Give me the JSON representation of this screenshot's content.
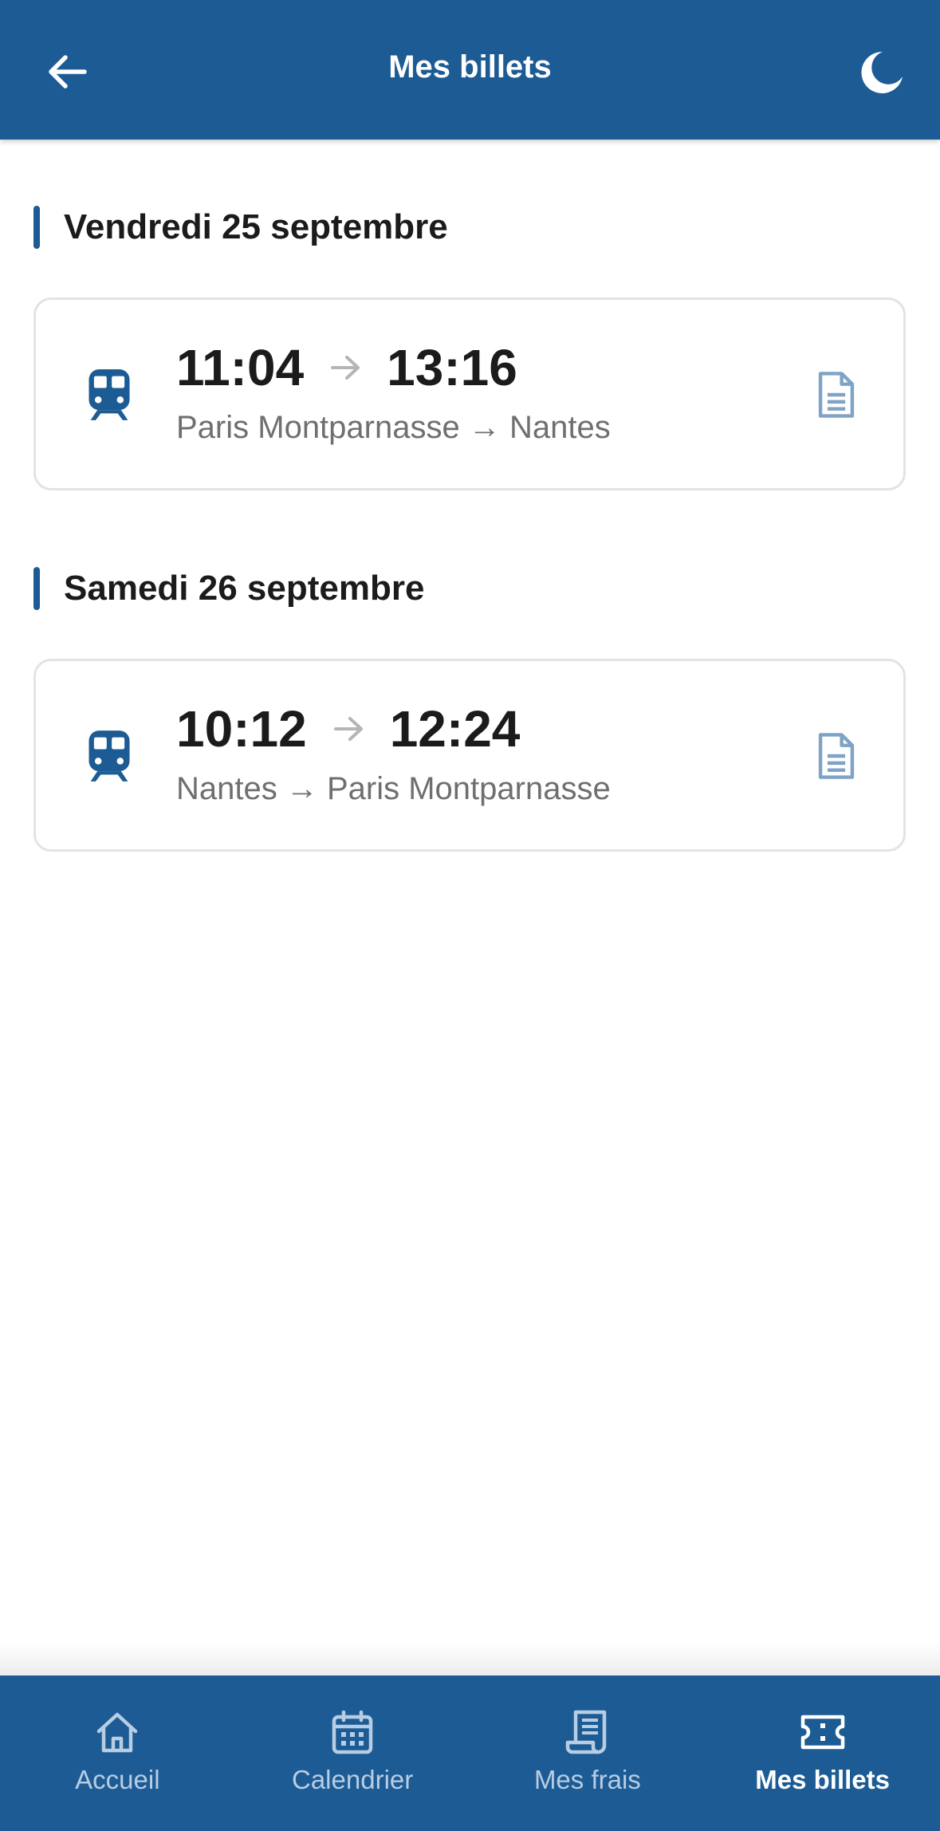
{
  "header": {
    "title": "Mes billets",
    "back_icon": "arrow-left-icon",
    "theme_icon": "moon-icon"
  },
  "sections": [
    {
      "date": "Vendredi 25 septembre",
      "tickets": [
        {
          "departure_time": "11:04",
          "arrival_time": "13:16",
          "route": "Paris Montparnasse → Nantes"
        }
      ]
    },
    {
      "date": "Samedi 26 septembre",
      "tickets": [
        {
          "departure_time": "10:12",
          "arrival_time": "12:24",
          "route": "Nantes → Paris Montparnasse"
        }
      ]
    }
  ],
  "bottom_nav": {
    "items": [
      {
        "label": "Accueil",
        "icon": "home-icon",
        "active": false
      },
      {
        "label": "Calendrier",
        "icon": "calendar-icon",
        "active": false
      },
      {
        "label": "Mes frais",
        "icon": "receipt-icon",
        "active": false
      },
      {
        "label": "Mes billets",
        "icon": "ticket-icon",
        "active": true
      }
    ]
  },
  "colors": {
    "primary": "#1d5b94",
    "nav_inactive": "#b7cde4",
    "doc_icon": "#7fa3c6",
    "card_border": "#e3e3e3"
  }
}
